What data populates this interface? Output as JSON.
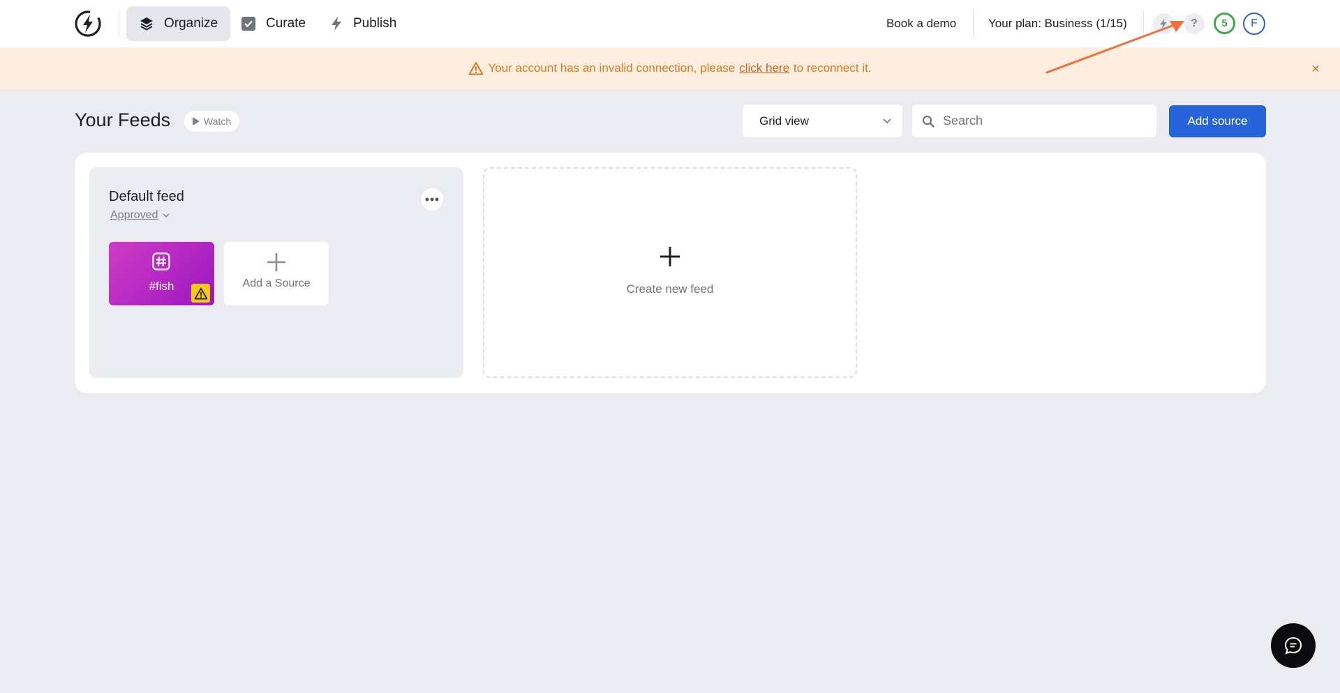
{
  "nav": {
    "logo": "bolt-logo",
    "items": [
      {
        "label": "Organize",
        "icon": "layers-icon",
        "active": true
      },
      {
        "label": "Curate",
        "icon": "checkbox-icon",
        "active": false
      },
      {
        "label": "Publish",
        "icon": "lightning-icon",
        "active": false
      }
    ],
    "book_demo": "Book a demo",
    "plan": "Your plan: Business (1/15)",
    "help_symbol": "?",
    "notification_count": "5",
    "avatar_initial": "F"
  },
  "banner": {
    "text_before": "Your account has an invalid connection, please",
    "link_text": "click here",
    "text_after": "to reconnect it.",
    "close_symbol": "×"
  },
  "header": {
    "title": "Your Feeds",
    "watch_label": "Watch",
    "view_select": "Grid view",
    "search_placeholder": "Search",
    "add_source_label": "Add source"
  },
  "feeds": [
    {
      "title": "Default feed",
      "status": "Approved",
      "sources": [
        {
          "label": "#fish",
          "icon": "hashtag-icon",
          "warning": true
        }
      ],
      "add_source_label": "Add a Source"
    }
  ],
  "create_feed_label": "Create new feed",
  "colors": {
    "accent": "#2764d9",
    "banner_bg": "#fdeedf",
    "banner_text": "#d9791e",
    "source_tile": "#b726c3",
    "count_ring": "#3eaa4a",
    "annotation_arrow": "#f0703b"
  }
}
